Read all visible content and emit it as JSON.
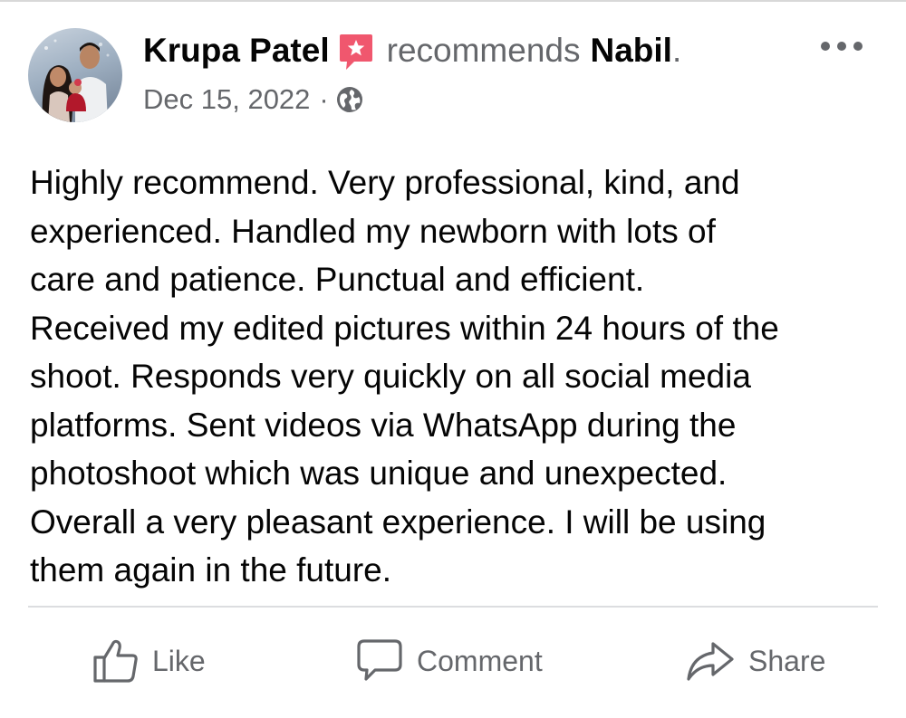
{
  "post": {
    "author_name": "Krupa Patel",
    "action_text": "recommends",
    "page_name": "Nabil",
    "page_name_suffix": ".",
    "date": "Dec 15, 2022",
    "meta_separator": "·",
    "privacy_icon": "globe-icon",
    "badge_icon": "recommendation-star-icon",
    "text_lines": [
      "Highly recommend. Very professional, kind, and",
      "experienced. Handled my newborn with lots of",
      "care and patience. Punctual and efficient.",
      "Received my edited pictures within 24 hours of the",
      "shoot. Responds very quickly on all social media",
      "platforms. Sent videos via WhatsApp during the",
      "photoshoot which was unique and unexpected.",
      "Overall a very pleasant experience. I will be using",
      "them again in the future."
    ]
  },
  "actions": {
    "like_label": "Like",
    "comment_label": "Comment",
    "share_label": "Share"
  },
  "colors": {
    "primary_text": "#050505",
    "secondary_text": "#65676b",
    "badge_pink": "#f0576e",
    "divider": "#dcdde0"
  }
}
